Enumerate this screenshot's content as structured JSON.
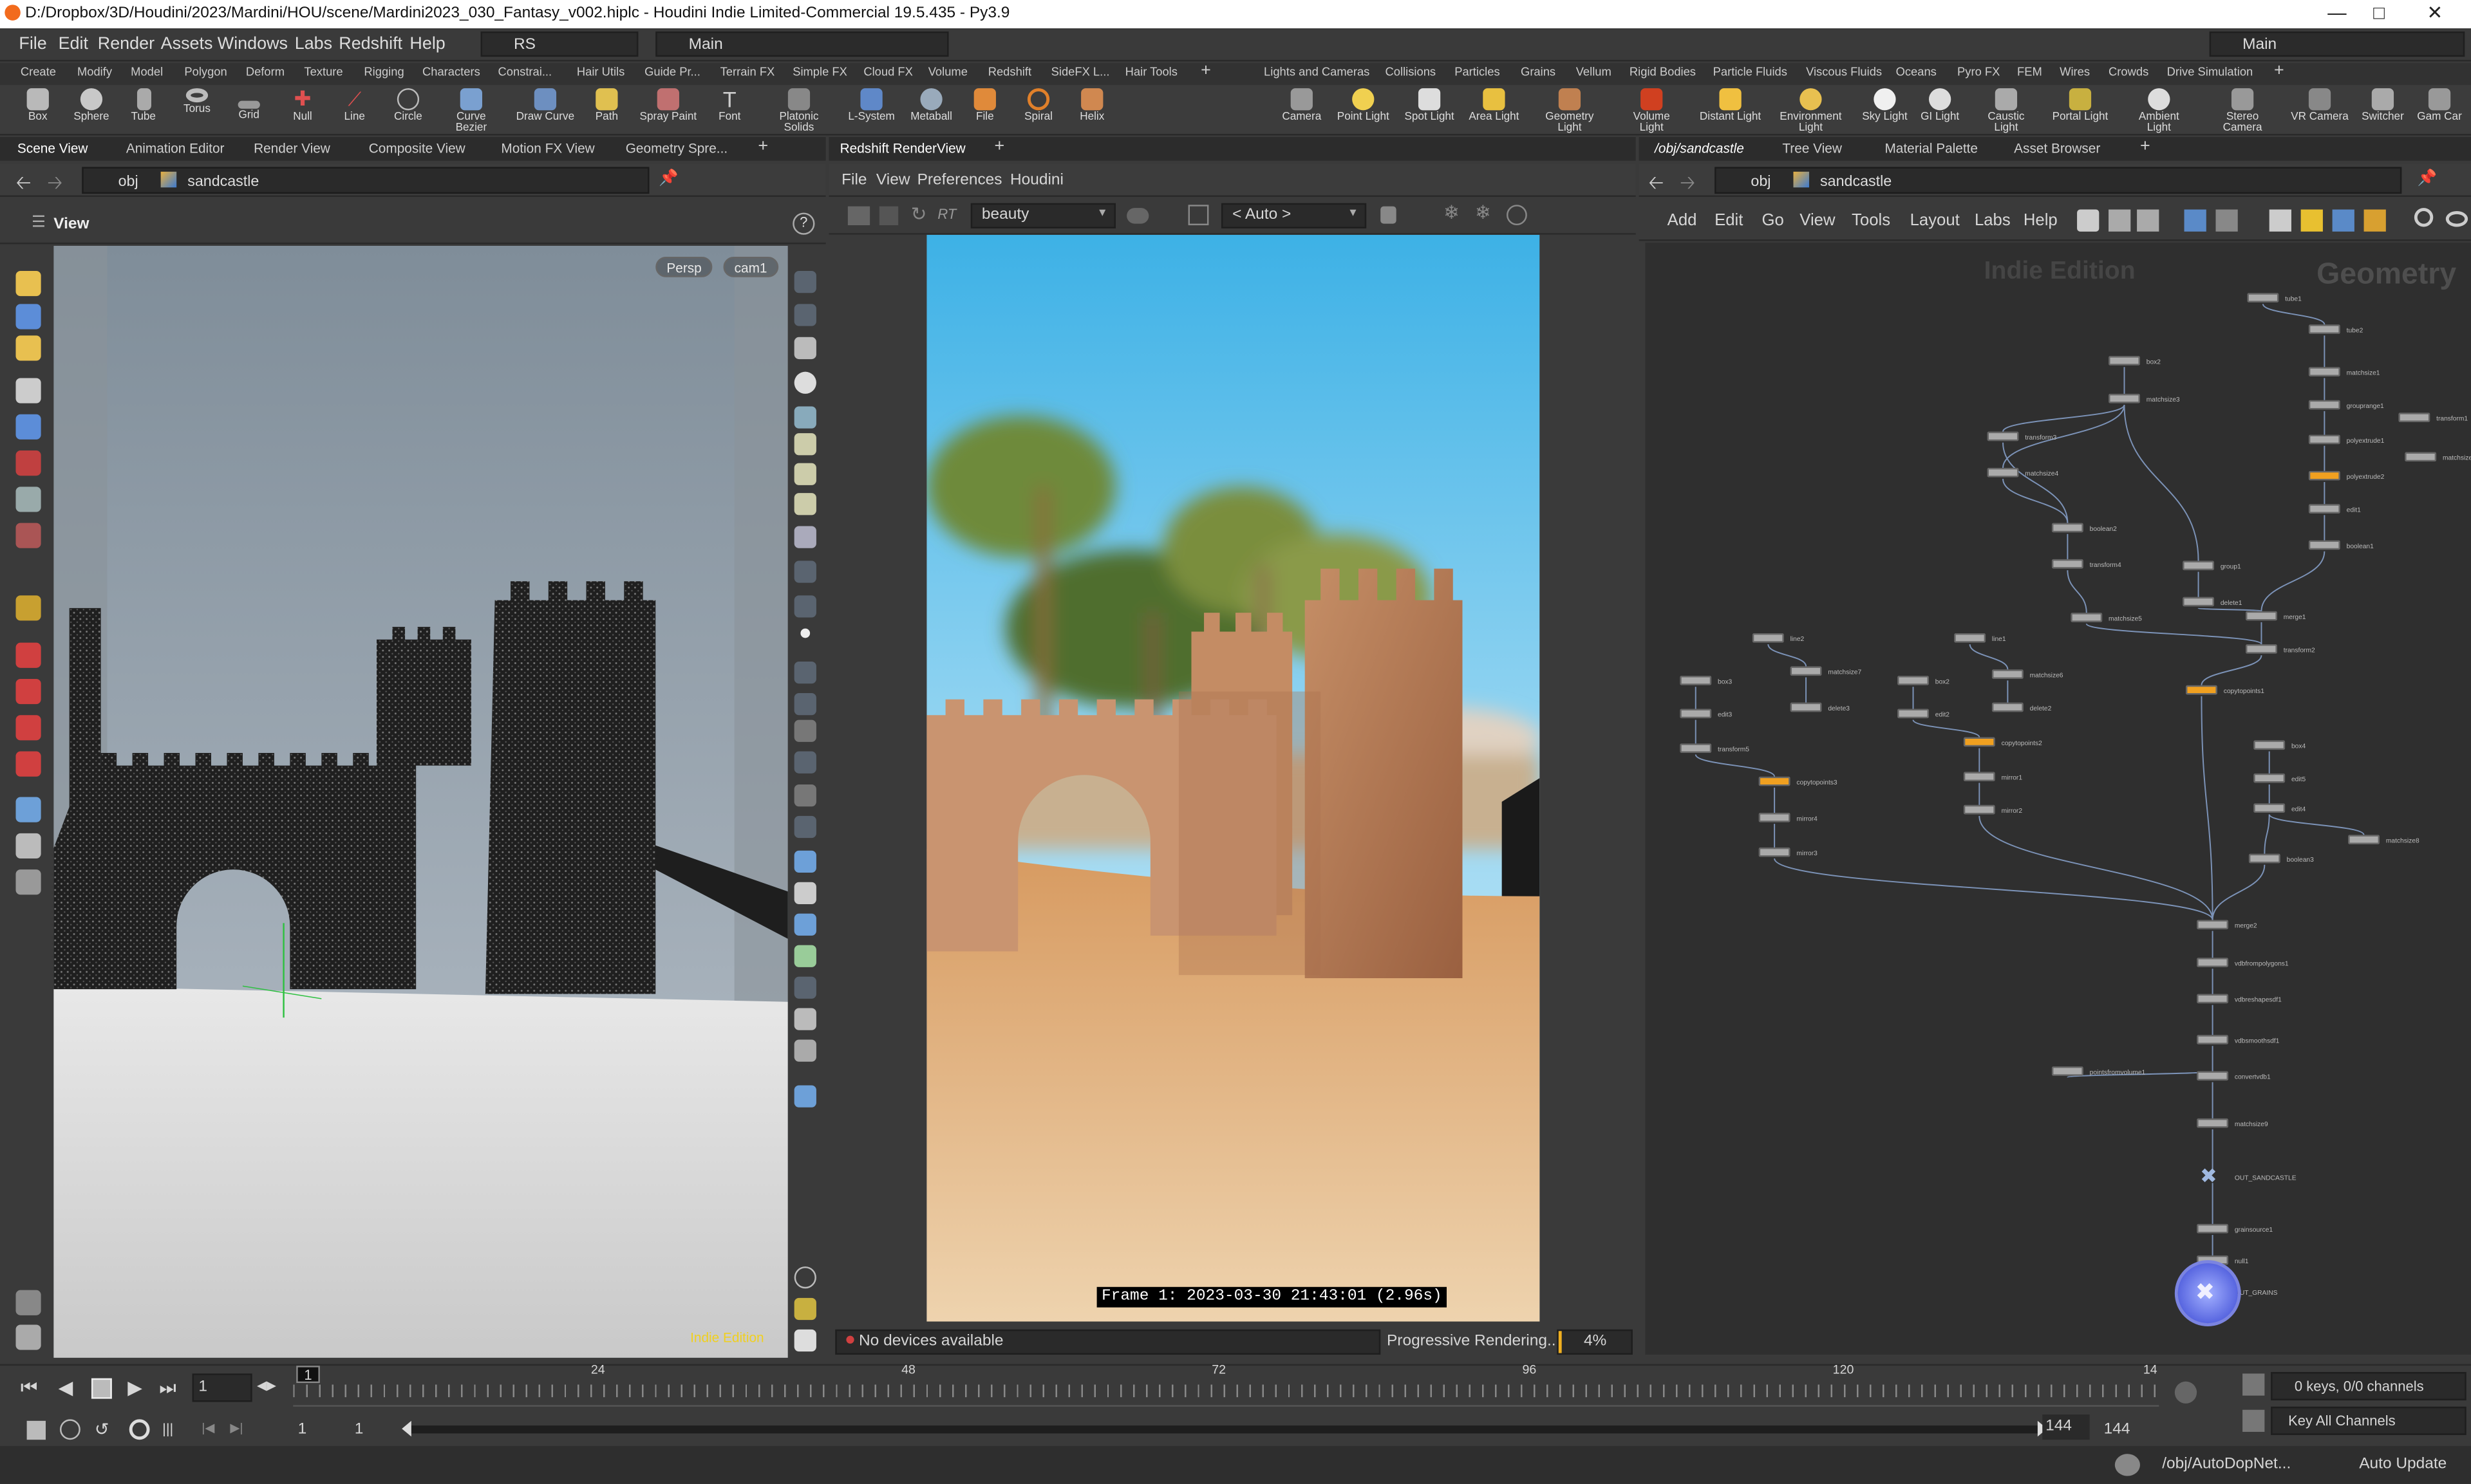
{
  "window": {
    "title": "D:/Dropbox/3D/Houdini/2023/Mardini/HOU/scene/Mardini2023_030_Fantasy_v002.hiplc - Houdini Indie Limited-Commercial 19.5.435 - Py3.9"
  },
  "menu": [
    "File",
    "Edit",
    "Render",
    "Assets",
    "Windows",
    "Labs",
    "Redshift",
    "Help"
  ],
  "menu_rs": "RS",
  "menu_desktop": "Main",
  "menu_desktop_right": "Main",
  "shelf_tabs_left": [
    "Create",
    "Modify",
    "Model",
    "Polygon",
    "Deform",
    "Texture",
    "Rigging",
    "Characters",
    "Constrai...",
    "Hair Utils",
    "Guide Pr...",
    "Terrain FX",
    "Simple FX",
    "Cloud FX",
    "Volume",
    "Redshift",
    "SideFX L...",
    "Hair Tools"
  ],
  "shelf_tabs_right": [
    "Lights and Cameras",
    "Collisions",
    "Particles",
    "Grains",
    "Vellum",
    "Rigid Bodies",
    "Particle Fluids",
    "Viscous Fluids",
    "Oceans",
    "Pyro FX",
    "FEM",
    "Wires",
    "Crowds",
    "Drive Simulation"
  ],
  "tools_left": [
    "Box",
    "Sphere",
    "Tube",
    "Torus",
    "Grid",
    "Null",
    "Line",
    "Circle",
    "Curve Bezier",
    "Draw Curve",
    "Path",
    "Spray Paint",
    "Font",
    "Platonic Solids",
    "L-System",
    "Metaball",
    "File",
    "Spiral",
    "Helix"
  ],
  "tools_right": [
    "Camera",
    "Point Light",
    "Spot Light",
    "Area Light",
    "Geometry Light",
    "Volume Light",
    "Distant Light",
    "Environment Light",
    "Sky Light",
    "GI Light",
    "Caustic Light",
    "Portal Light",
    "Ambient Light",
    "Stereo Camera",
    "VR Camera",
    "Switcher",
    "Gam Car"
  ],
  "pane_left_tabs": [
    "Scene View",
    "Animation Editor",
    "Render View",
    "Composite View",
    "Motion FX View",
    "Geometry Spre..."
  ],
  "pane_mid_tabs": [
    "Redshift RenderView"
  ],
  "pane_right_tabs": [
    "/obj/sandcastle",
    "Tree View",
    "Material Palette",
    "Asset Browser"
  ],
  "path_obj": "obj",
  "path_node": "sandcastle",
  "viewer": {
    "label": "View",
    "persp": "Persp",
    "cam": "cam1",
    "indie": "Indie Edition"
  },
  "render_menu": [
    "File",
    "View",
    "Preferences",
    "Houdini"
  ],
  "render_bar": {
    "rt": "RT",
    "aov": "beauty",
    "auto": "< Auto >"
  },
  "render_caption": "Frame  1:  2023-03-30  21:43:01  (2.96s)",
  "render_status": {
    "devices": "No devices available",
    "progress_text": "Progressive Rendering...",
    "progress_pct": "4%",
    "progress_value": 0.04
  },
  "network_menu": [
    "Add",
    "Edit",
    "Go",
    "View",
    "Tools",
    "Layout",
    "Labs",
    "Help"
  ],
  "network_watermarks": {
    "edition": "Indie Edition",
    "context": "Geometry"
  },
  "nodes": [
    {
      "label": "tube1",
      "orange": false
    },
    {
      "label": "tube2",
      "orange": false
    },
    {
      "label": "box2",
      "orange": false
    },
    {
      "label": "matchsize1",
      "orange": false
    },
    {
      "label": "matchsize3",
      "orange": false
    },
    {
      "label": "grouprange1",
      "orange": false
    },
    {
      "label": "transform1",
      "orange": false
    },
    {
      "label": "polyextrude1",
      "orange": false
    },
    {
      "label": "transform3",
      "orange": false
    },
    {
      "label": "matchsize4",
      "orange": false
    },
    {
      "label": "polyextrude2",
      "orange": true
    },
    {
      "label": "matchsize",
      "orange": false
    },
    {
      "label": "edit1",
      "orange": false
    },
    {
      "label": "boolean2",
      "orange": false
    },
    {
      "label": "boolean1",
      "orange": false
    },
    {
      "label": "transform4",
      "orange": false
    },
    {
      "label": "group1",
      "orange": false
    },
    {
      "label": "delete1",
      "orange": false
    },
    {
      "label": "merge1",
      "orange": false
    },
    {
      "label": "matchsize5",
      "orange": false
    },
    {
      "label": "line2",
      "orange": false
    },
    {
      "label": "line1",
      "orange": false
    },
    {
      "label": "transform2",
      "orange": false
    },
    {
      "label": "box3",
      "orange": false
    },
    {
      "label": "matchsize7",
      "orange": false
    },
    {
      "label": "box2",
      "orange": false
    },
    {
      "label": "matchsize6",
      "orange": false
    },
    {
      "label": "copytopoints1",
      "orange": true
    },
    {
      "label": "edit3",
      "orange": false
    },
    {
      "label": "delete3",
      "orange": false
    },
    {
      "label": "edit2",
      "orange": false
    },
    {
      "label": "delete2",
      "orange": false
    },
    {
      "label": "box4",
      "orange": false
    },
    {
      "label": "transform5",
      "orange": false
    },
    {
      "label": "copytopoints2",
      "orange": true
    },
    {
      "label": "edit5",
      "orange": false
    },
    {
      "label": "copytopoints3",
      "orange": true
    },
    {
      "label": "mirror1",
      "orange": false
    },
    {
      "label": "edit4",
      "orange": false
    },
    {
      "label": "mirror4",
      "orange": false
    },
    {
      "label": "mirror2",
      "orange": false
    },
    {
      "label": "matchsize8",
      "orange": false
    },
    {
      "label": "mirror3",
      "orange": false
    },
    {
      "label": "boolean3",
      "orange": false
    },
    {
      "label": "merge2",
      "orange": false
    },
    {
      "label": "vdbfrompolygons1",
      "orange": false
    },
    {
      "label": "vdbreshapesdf1",
      "orange": false
    },
    {
      "label": "vdbsmoothsdf1",
      "orange": false
    },
    {
      "label": "pointsfromvolume1",
      "orange": false
    },
    {
      "label": "convertvdb1",
      "orange": false
    },
    {
      "label": "matchsize9",
      "orange": false
    },
    {
      "label": "OUT_SANDCASTLE",
      "orange": false
    },
    {
      "label": "grainsource1",
      "orange": false
    },
    {
      "label": "null1",
      "orange": false
    },
    {
      "label": "OUT_GRAINS",
      "orange": false
    }
  ],
  "timeline": {
    "frame": "1",
    "ticks": [
      "24",
      "48",
      "72",
      "96",
      "120",
      "14"
    ],
    "start": "1",
    "start2": "1",
    "end": "144",
    "end2": "144",
    "keys": "0 keys, 0/0 channels",
    "key_all": "Key All Channels"
  },
  "status": {
    "path": "/obj/AutoDopNet...",
    "auto_update": "Auto Update"
  }
}
